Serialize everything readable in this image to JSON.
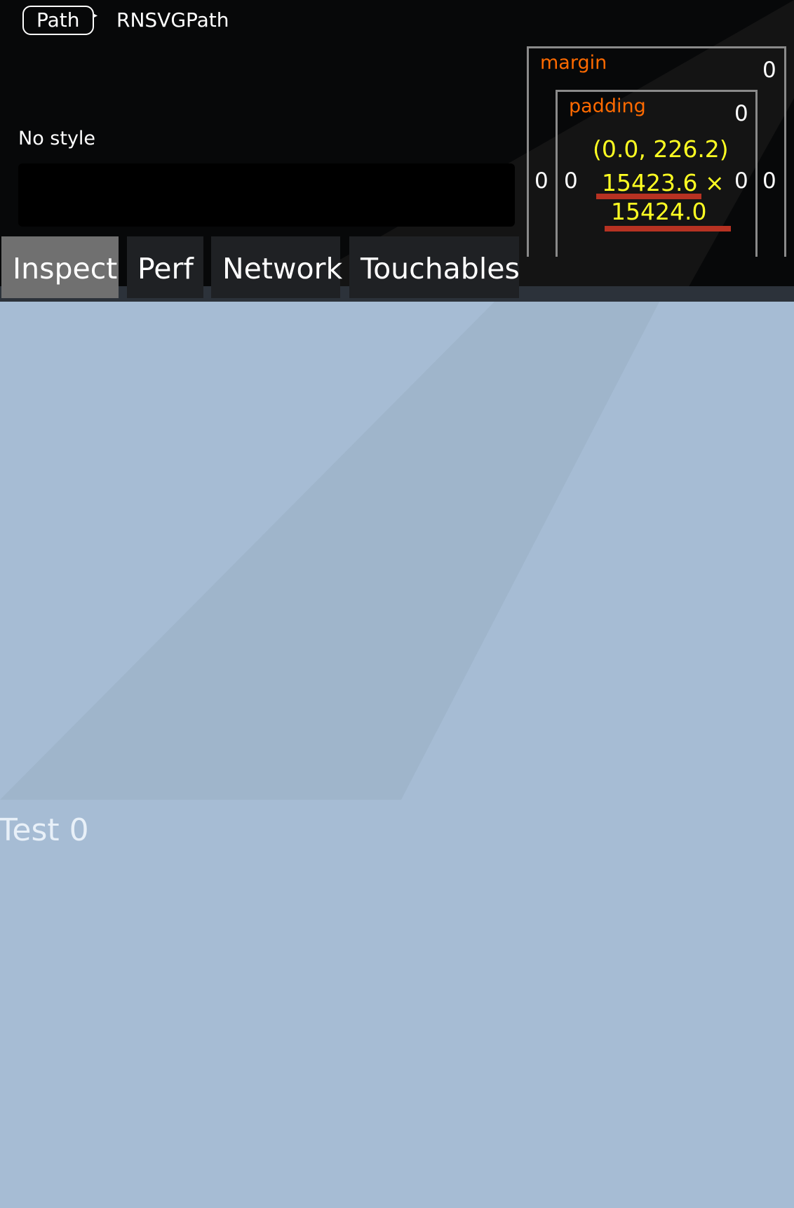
{
  "inspector": {
    "breadcrumb": {
      "selected": "Path",
      "next": "RNSVGPath"
    },
    "style_label": "No style",
    "box_model": {
      "margin_label": "margin",
      "padding_label": "padding",
      "margin_top": "0",
      "margin_left": "0",
      "margin_right": "0",
      "padding_top": "0",
      "padding_left": "0",
      "padding_right": "0",
      "position": "(0.0, 226.2)",
      "width": "15423.6 ×",
      "height": "15424.0"
    },
    "tabs": [
      {
        "label": "Inspect",
        "active": true
      },
      {
        "label": "Perf",
        "active": false
      },
      {
        "label": "Network",
        "active": false
      },
      {
        "label": "Touchables",
        "active": false
      }
    ]
  },
  "content": {
    "label": "Test 0"
  },
  "colors": {
    "page_background": "#a6bcd4",
    "accent_orange": "#ff6a00",
    "accent_yellow": "#ffff22",
    "underline_red": "#b73222",
    "active_tab": "#707070"
  }
}
